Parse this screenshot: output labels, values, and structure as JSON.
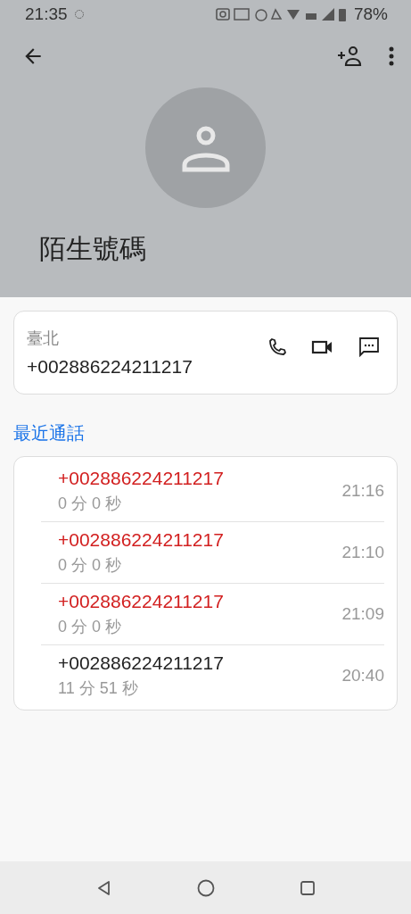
{
  "status_bar": {
    "time": "21:35",
    "battery": "78%"
  },
  "contact": {
    "name": "陌生號碼"
  },
  "number_card": {
    "location": "臺北",
    "number": "+002886224211217"
  },
  "recent": {
    "title": "最近通話",
    "calls": [
      {
        "number": "+002886224211217",
        "duration": "0 分 0 秒",
        "time": "21:16",
        "missed": true
      },
      {
        "number": "+002886224211217",
        "duration": "0 分 0 秒",
        "time": "21:10",
        "missed": true
      },
      {
        "number": "+002886224211217",
        "duration": "0 分 0 秒",
        "time": "21:09",
        "missed": true
      },
      {
        "number": "+002886224211217",
        "duration": "11 分 51 秒",
        "time": "20:40",
        "missed": false
      }
    ]
  }
}
